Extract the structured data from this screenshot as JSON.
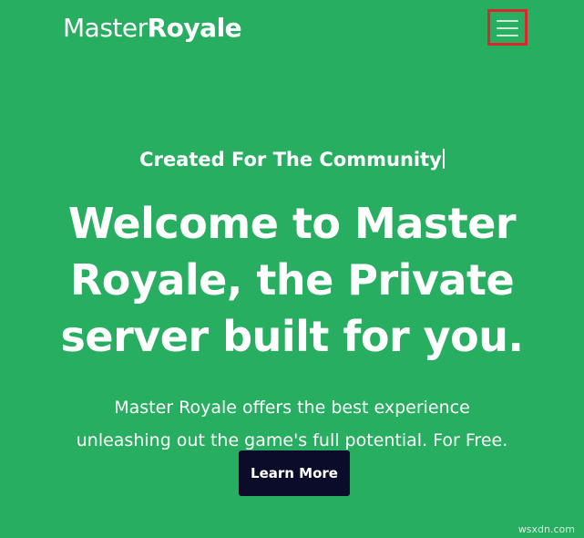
{
  "header": {
    "logo_light": "Master",
    "logo_bold": "Royale",
    "menu_icon": "hamburger-menu-icon"
  },
  "hero": {
    "tagline": "Created For The Community",
    "headline_lines": [
      "Welcome to Master",
      "Royale, the Private",
      "server built for you."
    ],
    "subtext_lines": [
      "Master Royale offers the best experience",
      "unleashing out the game's full potential. For Free."
    ],
    "cta_label": "Learn More"
  },
  "watermark": "wsxdn.com",
  "colors": {
    "background": "#27ae60",
    "cta_background": "#0b0c2a",
    "highlight_border": "#e0242b",
    "text": "#ffffff"
  }
}
